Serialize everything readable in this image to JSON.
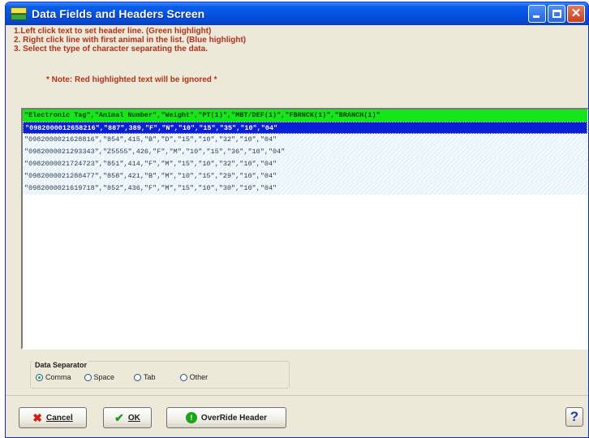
{
  "window": {
    "title": "Data Fields and Headers Screen",
    "min_symbol": "",
    "close_symbol": "✕"
  },
  "instructions": [
    "1.Left click text to set header line. (Green highlight)",
    "2. Right click line with first animal in the list. (Blue highlight)",
    "3. Select the type of character separating the data."
  ],
  "note": "* Note: Red highlighted text will be ignored *",
  "data_list": {
    "header_row": "\"Electronic Tag\",\"Animal Number\",\"Weight\",\"PT(1)\",\"MBT/DEF(1)\",\"FBRNCK(1)\",\"BRANCH(1)\"",
    "selected_row": "\"0982000012658216\",\"887\",389,\"F\",\"N\",\"10\",\"15\",\"35\",\"10\",\"04\"",
    "rows": [
      "\"0982000021628816\",\"854\",415,\"B\",\"D\",\"15\",\"10\",\"32\",\"10\",\"04\"",
      "\"0982000021293343\",\"Z5555\",426,\"F\",\"M\",\"10\",\"15\",\"36\",\"10\",\"04\"",
      "\"0982000021724723\",\"851\",414,\"F\",\"M\",\"15\",\"10\",\"32\",\"10\",\"04\"",
      "\"0982000021288477\",\"858\",421,\"B\",\"M\",\"10\",\"15\",\"29\",\"10\",\"04\"",
      "\"0982000021619718\",\"852\",436,\"F\",\"M\",\"15\",\"10\",\"30\",\"10\",\"04\""
    ],
    "colors": {
      "header_bg": "#15e61a",
      "selected_bg": "#0a1fd6"
    }
  },
  "separator": {
    "label": "Data Separator",
    "options": [
      "Comma",
      "Space",
      "Tab",
      "Other"
    ],
    "selected": "Comma"
  },
  "buttons": {
    "cancel": "Cancel",
    "ok": "OK",
    "override": "OverRide Header",
    "help": "?"
  },
  "icons": {
    "cancel": "x-mark-icon",
    "ok": "check-mark-icon",
    "override": "override-header-icon",
    "help": "help-icon",
    "app": "app-icon"
  }
}
